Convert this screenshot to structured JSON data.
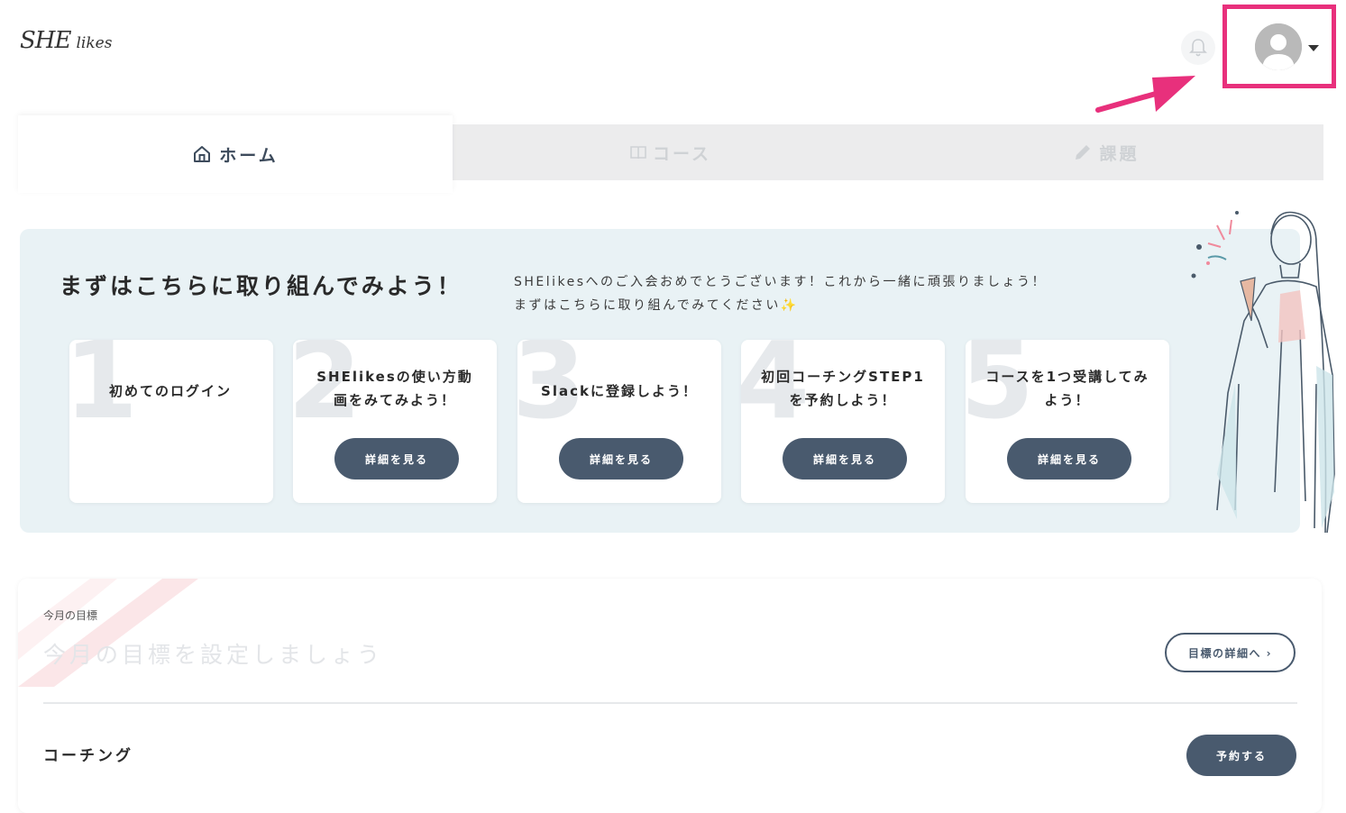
{
  "header": {
    "logo_main": "SHE",
    "logo_sub": "likes",
    "bell_icon": "bell-icon",
    "avatar_icon": "user-avatar-icon",
    "highlight_color": "#e8307c"
  },
  "tabs": [
    {
      "label": "ホーム",
      "icon": "home-icon",
      "active": true
    },
    {
      "label": "コース",
      "icon": "book-icon",
      "active": false
    },
    {
      "label": "課題",
      "icon": "pencil-icon",
      "active": false
    }
  ],
  "onboarding": {
    "title": "まずはこちらに取り組んでみよう！",
    "message_line1": "SHElikesへのご入会おめでとうございます！これから一緒に頑張りましょう！",
    "message_line2": "まずはこちらに取り組んでみてください",
    "sparkle": "✨",
    "steps": [
      {
        "number": "1",
        "title": "初めてのログイン",
        "button": ""
      },
      {
        "number": "2",
        "title": "SHElikesの使い方動画をみてみよう！",
        "button": "詳細を見る"
      },
      {
        "number": "3",
        "title": "Slackに登録しよう！",
        "button": "詳細を見る"
      },
      {
        "number": "4",
        "title": "初回コーチングSTEP1を予約しよう！",
        "button": "詳細を見る"
      },
      {
        "number": "5",
        "title": "コースを1つ受講してみよう！",
        "button": "詳細を見る"
      }
    ]
  },
  "goal": {
    "label": "今月の目標",
    "placeholder": "今月の目標を設定しましょう",
    "detail_button": "目標の詳細へ ›"
  },
  "coaching": {
    "label": "コーチング",
    "reserve_button": "予約する"
  },
  "colors": {
    "button_dark": "#495a6e",
    "panel_bg": "#e9f2f5"
  }
}
